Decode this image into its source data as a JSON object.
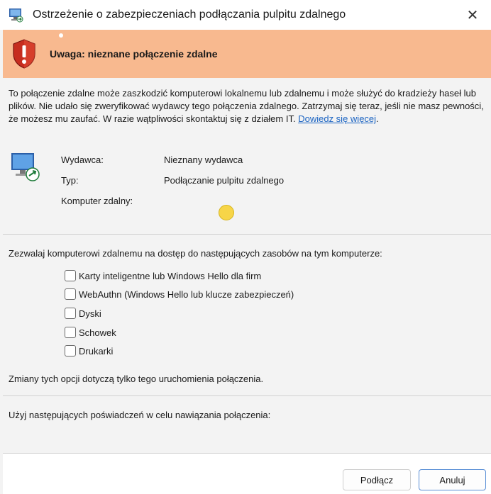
{
  "window": {
    "title": "Ostrzeżenie o zabezpieczeniach podłączania pulpitu zdalnego",
    "close_glyph": "✕"
  },
  "banner": {
    "heading": "Uwaga: nieznane połączenie zdalne",
    "color": "#f8b98f"
  },
  "intro": {
    "text": "To połączenie zdalne może zaszkodzić komputerowi lokalnemu lub zdalnemu i może służyć do kradzieży haseł lub plików. Nie udało się zweryfikować wydawcy tego połączenia zdalnego. Zatrzymaj się teraz, jeśli nie masz pewności, że możesz mu zaufać. W razie wątpliwości skontaktuj się z działem IT.",
    "link": "Dowiedz się więcej",
    "link_color": "#1a63c2"
  },
  "details": [
    {
      "label": "Wydawca:",
      "value": "Nieznany wydawca"
    },
    {
      "label": "Typ:",
      "value": "Podłączanie pulpitu zdalnego"
    },
    {
      "label": "Komputer zdalny:",
      "value": ""
    }
  ],
  "resources": {
    "prompt": "Zezwalaj komputerowi zdalnemu na dostęp do następujących zasobów na tym komputerze:",
    "options": [
      {
        "label": "Karty inteligentne lub Windows Hello dla firm",
        "checked": false
      },
      {
        "label": "WebAuthn (Windows Hello lub klucze zabezpieczeń)",
        "checked": false
      },
      {
        "label": "Dyski",
        "checked": false
      },
      {
        "label": "Schowek",
        "checked": false
      },
      {
        "label": "Drukarki",
        "checked": false
      }
    ],
    "note": "Zmiany tych opcji dotyczą tylko tego uruchomienia połączenia."
  },
  "credentials": {
    "text": "Użyj następujących poświadczeń w celu nawiązania połączenia:"
  },
  "buttons": {
    "connect": "Podłącz",
    "cancel": "Anuluj"
  },
  "icons": {
    "app": "remote-desktop-icon",
    "shield": "warning-shield-icon",
    "computer": "remote-computer-icon"
  }
}
